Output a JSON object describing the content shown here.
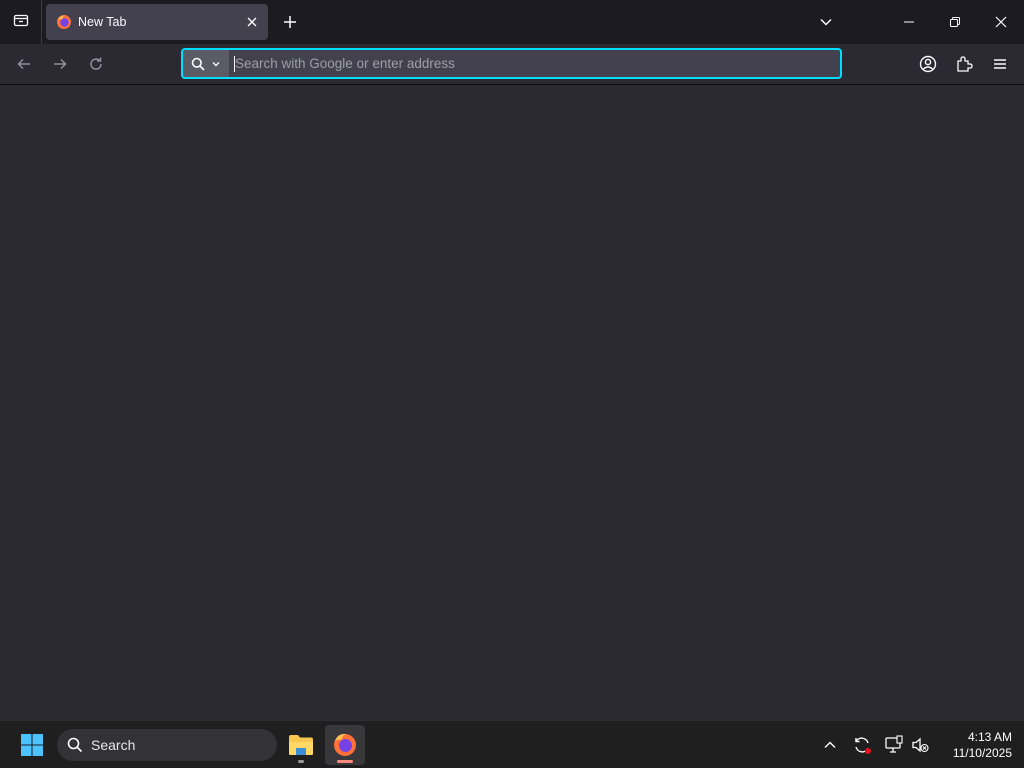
{
  "tabs": [
    {
      "title": "New Tab",
      "favicon": "firefox-icon",
      "active": true
    }
  ],
  "urlbar": {
    "placeholder": "Search with Google or enter address",
    "value": "",
    "focused_border": "#00ddff"
  },
  "toolbar": {
    "back_icon": "back-arrow-icon",
    "forward_icon": "forward-arrow-icon",
    "reload_icon": "reload-icon",
    "account_icon": "account-icon",
    "extensions_icon": "extensions-icon",
    "menu_icon": "hamburger-menu-icon"
  },
  "taskbar": {
    "search_label": "Search",
    "apps": [
      {
        "name": "File Explorer",
        "icon": "folder-icon"
      },
      {
        "name": "Firefox",
        "icon": "firefox-icon",
        "active": true
      }
    ],
    "clock": {
      "time": "4:13 AM",
      "date": "11/10/2025"
    }
  },
  "colors": {
    "tabstrip_bg": "#1c1b22",
    "toolbar_bg": "#2b2a33",
    "active_tab_bg": "#42414d",
    "content_bg": "#2b2a33",
    "taskbar_bg": "#1f1f20",
    "accent": "#00ddff"
  }
}
